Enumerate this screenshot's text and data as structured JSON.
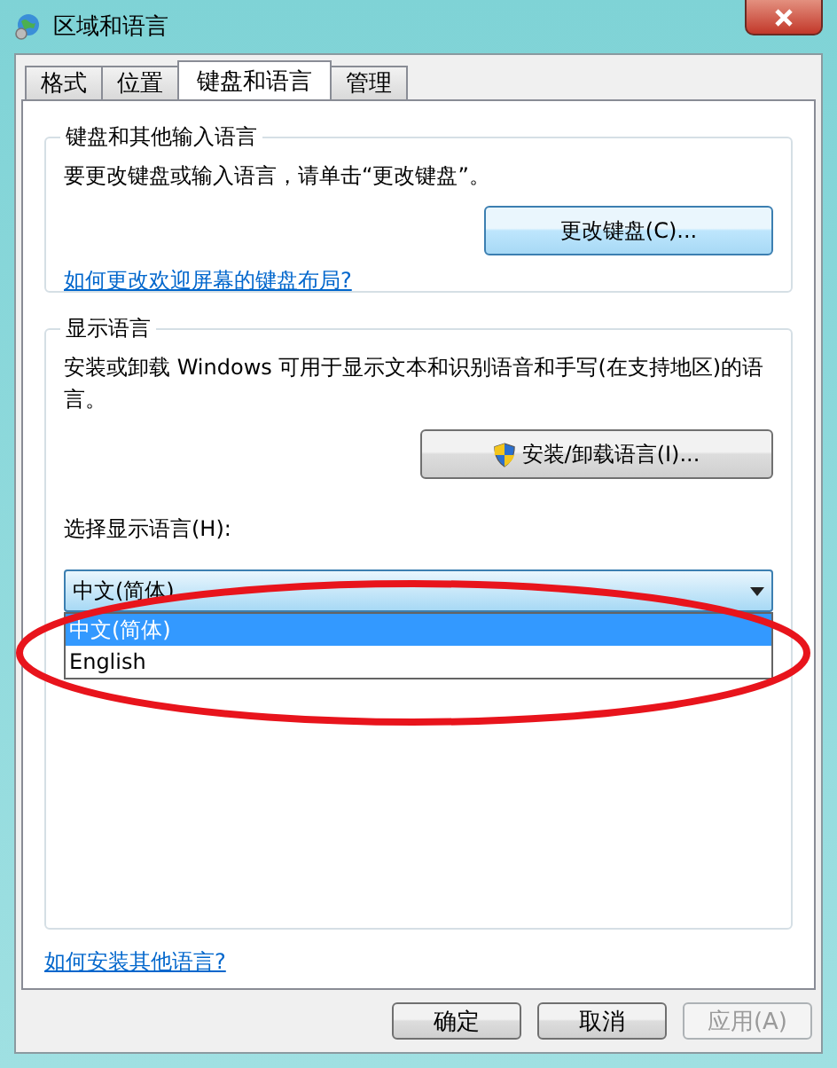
{
  "window": {
    "title": "区域和语言"
  },
  "tabs": [
    {
      "label": "格式",
      "selected": false
    },
    {
      "label": "位置",
      "selected": false
    },
    {
      "label": "键盘和语言",
      "selected": true
    },
    {
      "label": "管理",
      "selected": false
    }
  ],
  "keyboard_group": {
    "title": "键盘和其他输入语言",
    "text": "要更改键盘或输入语言，请单击“更改键盘”。",
    "button": "更改键盘(C)...",
    "link": "如何更改欢迎屏幕的键盘布局?"
  },
  "display_group": {
    "title": "显示语言",
    "text": "安装或卸载 Windows 可用于显示文本和识别语音和手写(在支持地区)的语言。",
    "button": "安装/卸载语言(I)...",
    "select_label": "选择显示语言(H):",
    "select_value": "中文(简体)",
    "expanded": true,
    "options": [
      {
        "label": "中文(简体)",
        "selected": true
      },
      {
        "label": "English",
        "selected": false
      }
    ]
  },
  "link": "如何安装其他语言?",
  "buttons": [
    {
      "label": "确定",
      "disabled": false
    },
    {
      "label": "取消",
      "disabled": false
    },
    {
      "label": "应用(A)",
      "disabled": true
    }
  ],
  "highlight": {
    "kind": "ellipse"
  }
}
